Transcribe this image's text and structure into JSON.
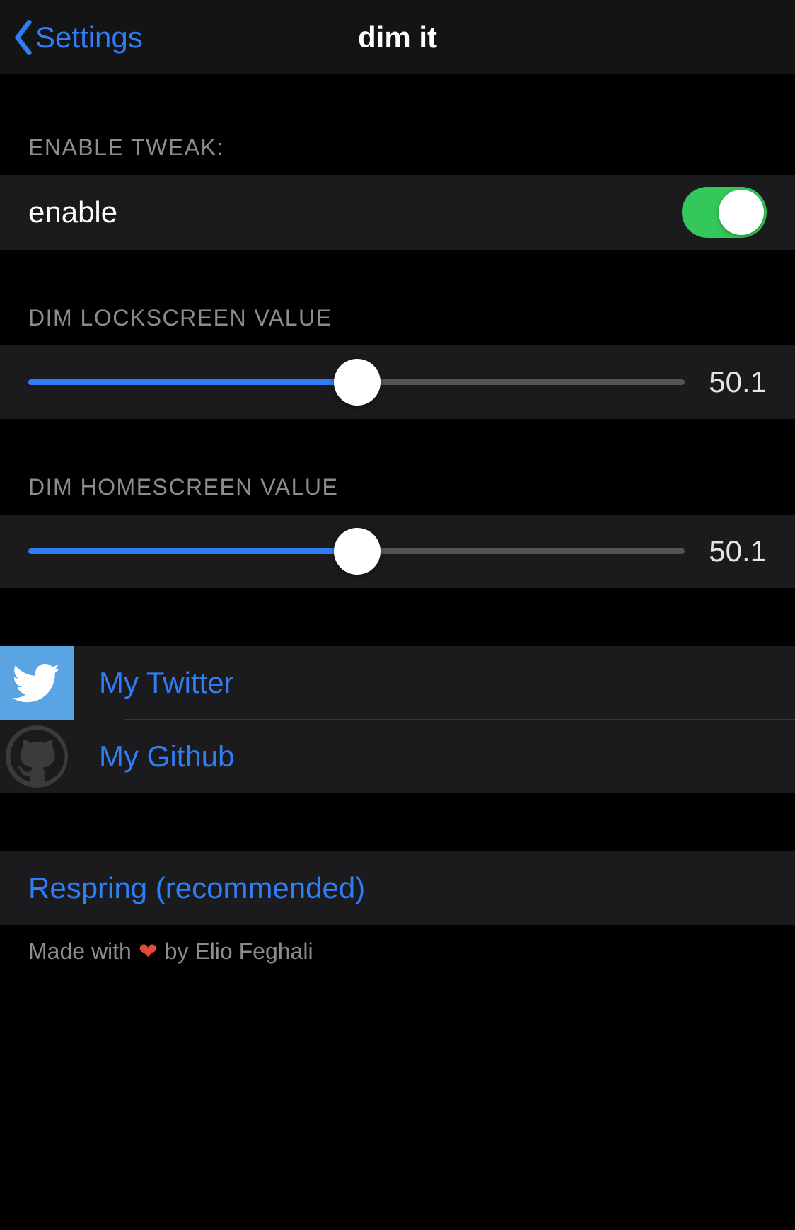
{
  "nav": {
    "back": "Settings",
    "title": "dim it"
  },
  "enable_section": {
    "header": "ENABLE TWEAK:",
    "label": "enable",
    "on": true
  },
  "lock_section": {
    "header": "DIM LOCKSCREEN VALUE",
    "value_text": "50.1",
    "percent": 50.1
  },
  "home_section": {
    "header": "DIM HOMESCREEN VALUE",
    "value_text": "50.1",
    "percent": 50.1
  },
  "links": {
    "twitter": "My Twitter",
    "github": "My Github"
  },
  "respring": "Respring (recommended)",
  "footer": {
    "pre": "Made with",
    "heart": "❤",
    "post": "by Elio Feghali"
  }
}
